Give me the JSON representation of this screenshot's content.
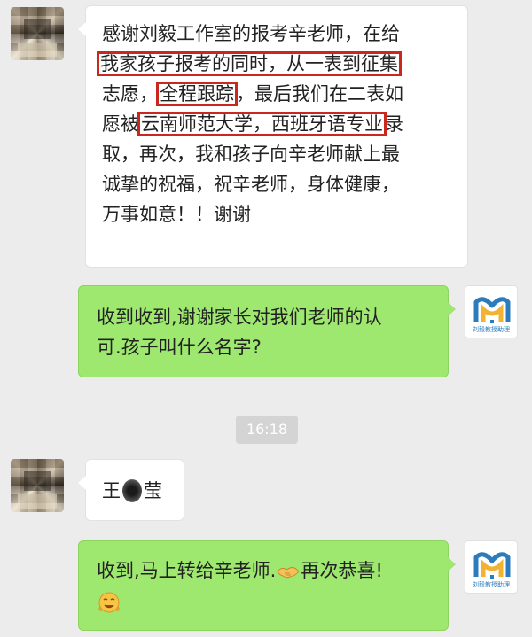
{
  "messages": {
    "m1": {
      "lines": [
        "感谢刘毅工作室的报考辛老师，在给",
        "我家孩子报考的同时，从一表到征集",
        "志愿，",
        "全程跟踪",
        "，最后我们在二表如",
        "愿被",
        "云南师范大学，西班牙语专业",
        "录",
        "取，再次，我和孩子向辛老师献上最",
        "诚挚的祝福，祝辛老师，身体健康，",
        "万事如意！！谢谢"
      ]
    },
    "m2": {
      "lines": [
        "收到收到,谢谢家长对我们老师的认",
        "可.孩子叫什么名字?"
      ]
    },
    "time": "16:18",
    "m3": {
      "part1": "王",
      "part2": "莹"
    },
    "m4": {
      "text": "收到,马上转给辛老师.",
      "text2": "再次恭喜!"
    }
  },
  "logo": {
    "caption": "刘毅教授助理"
  },
  "icons": {
    "hands": "handshake-icon",
    "face": "smiling-face-icon"
  },
  "colors": {
    "background": "#ececec",
    "green_bubble": "#9fe870",
    "white_bubble": "#ffffff",
    "highlight": "#c8281e",
    "logo_blue": "#2b7bbd",
    "logo_yellow": "#f2b233"
  }
}
